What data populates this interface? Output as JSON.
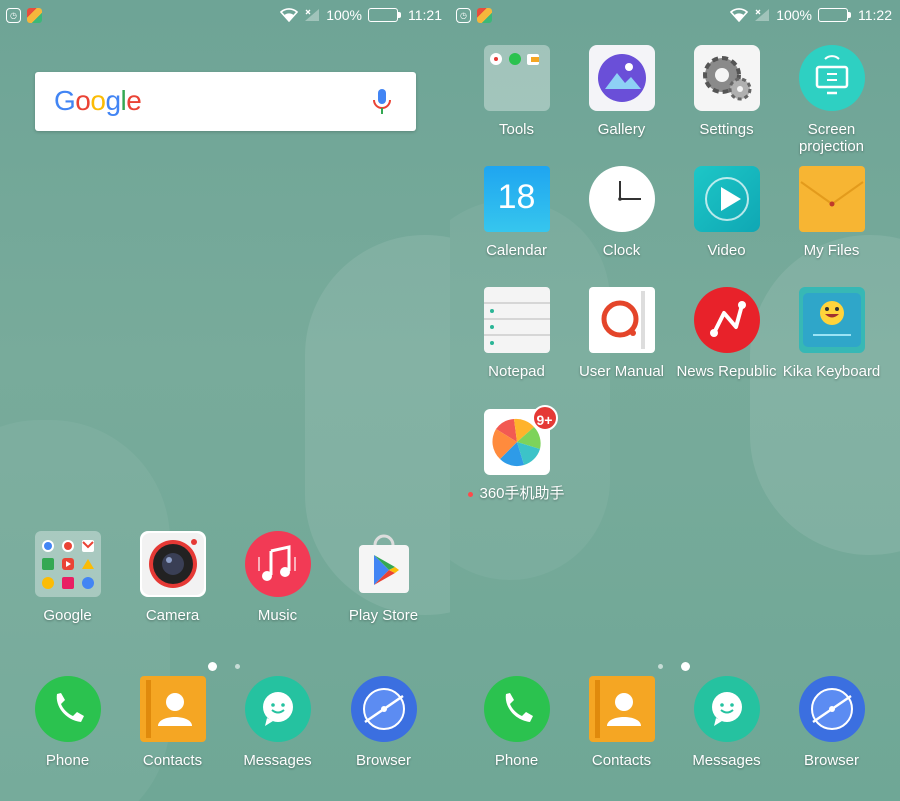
{
  "status_left": {
    "time": "11:21",
    "battery": "100%"
  },
  "status_right": {
    "time": "11:22",
    "battery": "100%"
  },
  "google_search": {
    "logo_text": "Google"
  },
  "left_apps": [
    {
      "label": "Google"
    },
    {
      "label": "Camera"
    },
    {
      "label": "Music"
    },
    {
      "label": "Play Store"
    }
  ],
  "right_apps": [
    {
      "label": "Tools"
    },
    {
      "label": "Gallery"
    },
    {
      "label": "Settings"
    },
    {
      "label": "Screen projection"
    },
    {
      "label": "Calendar",
      "date": "18"
    },
    {
      "label": "Clock"
    },
    {
      "label": "Video"
    },
    {
      "label": "My Files"
    },
    {
      "label": "Notepad"
    },
    {
      "label": "User Manual"
    },
    {
      "label": "News Republic"
    },
    {
      "label": "Kika Keyboard"
    },
    {
      "label": "360手机助手",
      "badge": "9+"
    }
  ],
  "dock": [
    {
      "label": "Phone"
    },
    {
      "label": "Contacts"
    },
    {
      "label": "Messages"
    },
    {
      "label": "Browser"
    }
  ],
  "page_indicator_left": {
    "pages": 2,
    "active": 1
  },
  "page_indicator_right": {
    "pages": 2,
    "active": 2
  },
  "colors": {
    "wallpaper": "#6ea496",
    "phone_green": "#2bc24f",
    "contacts_orange": "#f5a623",
    "messages_teal": "#25c2a0",
    "browser_blue": "#3b6fe0",
    "badge_red": "#e53935"
  }
}
